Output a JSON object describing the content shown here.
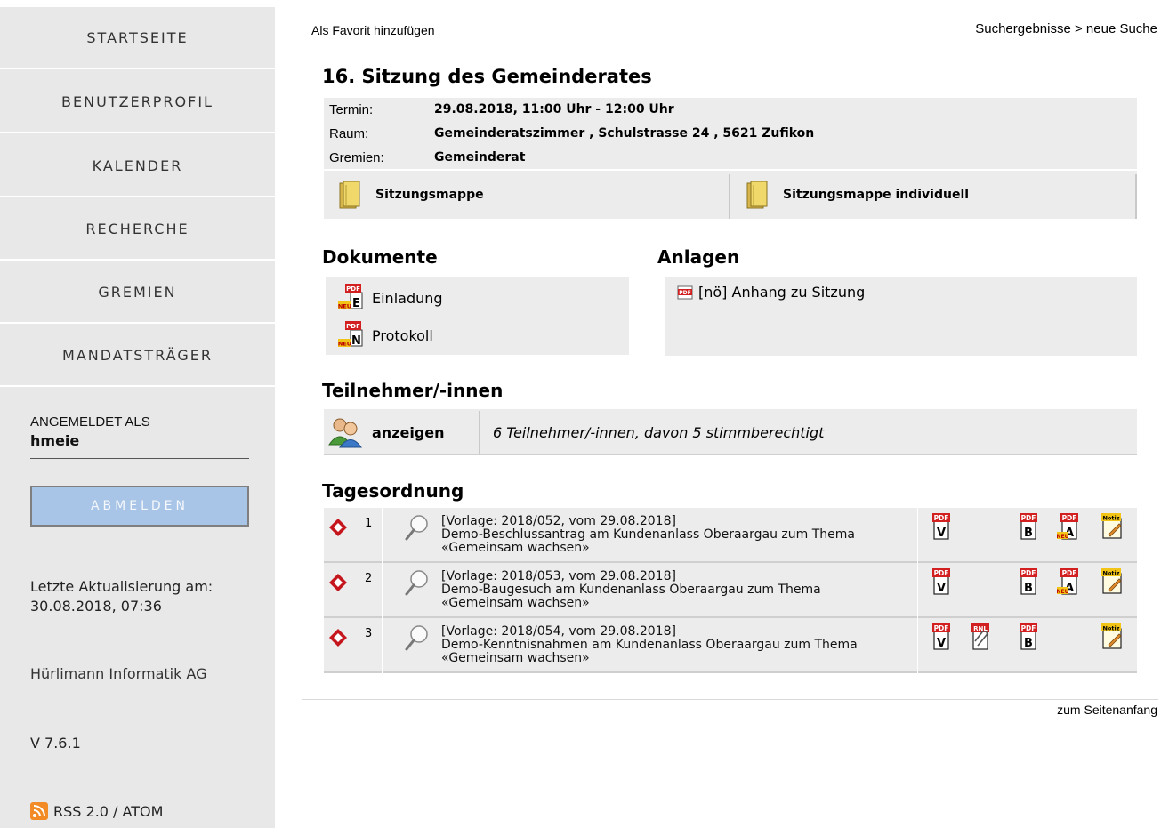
{
  "sidebar": {
    "nav": [
      "STARTSEITE",
      "BENUTZERPROFIL",
      "KALENDER",
      "RECHERCHE",
      "GREMIEN",
      "MANDATSTRÄGER"
    ],
    "login_label": "ANGEMELDET ALS",
    "login_user": "hmeie",
    "logout_label": "ABMELDEN",
    "update_label": "Letzte Aktualisierung am:",
    "update_date": "30.08.2018, 07:36",
    "company": "Hürlimann Informatik AG",
    "version": "V 7.6.1",
    "rss_label": "RSS 2.0 / ATOM",
    "rss_icon": "rss-icon"
  },
  "top": {
    "favorite": "Als Favorit hinzufügen",
    "search_results": "Suchergebnisse",
    "separator": ">",
    "new_search": "neue Suche"
  },
  "meeting": {
    "title": "16. Sitzung des Gemeinderates",
    "termin_label": "Termin:",
    "termin": "29.08.2018, 11:00 Uhr - 12:00 Uhr",
    "raum_label": "Raum:",
    "raum": "Gemeinderatszimmer , Schulstrasse 24 , 5621 Zufikon",
    "gremien_label": "Gremien:",
    "gremien": "Gemeinderat",
    "folder1": "Sitzungsmappe",
    "folder2": "Sitzungsmappe individuell"
  },
  "documents": {
    "heading": "Dokumente",
    "items": [
      {
        "label": "Einladung",
        "letter": "E"
      },
      {
        "label": "Protokoll",
        "letter": "N"
      }
    ],
    "pdf_text": "PDF",
    "neu_text": "NEU"
  },
  "attachments": {
    "heading": "Anlagen",
    "item": "[nö]  Anhang zu Sitzung"
  },
  "participants": {
    "heading": "Teilnehmer/-innen",
    "show": "anzeigen",
    "summary": "6 Teilnehmer/-innen, davon 5 stimmberechtigt"
  },
  "agenda": {
    "heading": "Tagesordnung",
    "rows": [
      {
        "num": "1",
        "line1": "[Vorlage: 2018/052, vom 29.08.2018]",
        "line2": "Demo-Beschlussantrag am Kundenanlass Oberaargau zum Thema",
        "line3": "«Gemeinsam wachsen»"
      },
      {
        "num": "2",
        "line1": "[Vorlage: 2018/053, vom 29.08.2018]",
        "line2": "Demo-Baugesuch am Kundenanlass Oberaargau zum Thema",
        "line3": "«Gemeinsam wachsen»"
      },
      {
        "num": "3",
        "line1": "[Vorlage: 2018/054, vom 29.08.2018]",
        "line2": "Demo-Kenntnisnahmen am Kundenanlass Oberaargau zum Thema",
        "line3": "«Gemeinsam wachsen»"
      }
    ],
    "icon_text": {
      "pdf": "PDF",
      "neu": "NEU",
      "notiz": "Notiz",
      "rnl": "RNL",
      "v": "V",
      "b": "B",
      "a": "A"
    }
  },
  "footer": {
    "to_top": "zum Seitenanfang"
  },
  "colors": {
    "sidebar_bg": "#e8e8e8",
    "box_bg": "#ececec",
    "logout_bg": "#a8c4e6",
    "pdf_red": "#d21f1f",
    "neu_yellow": "#f2c418",
    "rss_orange": "#f28b26"
  }
}
